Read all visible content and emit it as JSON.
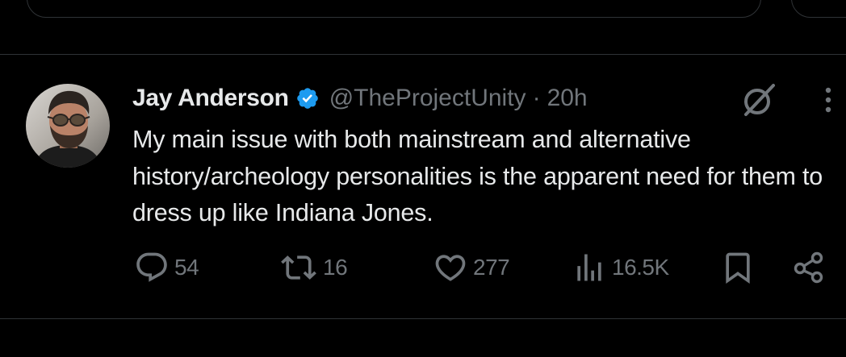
{
  "tweet": {
    "display_name": "Jay Anderson",
    "handle": "@TheProjectUnity",
    "separator": "·",
    "time": "20h",
    "text": "My main issue with both mainstream and alternative history/archeology personalities is the apparent need for them to dress up like Indiana Jones."
  },
  "actions": {
    "replies": "54",
    "reposts": "16",
    "likes": "277",
    "views": "16.5K"
  },
  "icons": {
    "verified": "verified-badge-icon",
    "grok": "grok-icon",
    "more": "more-vertical-icon",
    "reply": "reply-icon",
    "repost": "repost-icon",
    "like": "heart-icon",
    "views": "views-icon",
    "bookmark": "bookmark-icon",
    "share": "share-icon"
  },
  "colors": {
    "background": "#000000",
    "text_primary": "#e7e9ea",
    "text_secondary": "#71767b",
    "verified_blue": "#1d9bf0",
    "divider": "#2f3336"
  }
}
